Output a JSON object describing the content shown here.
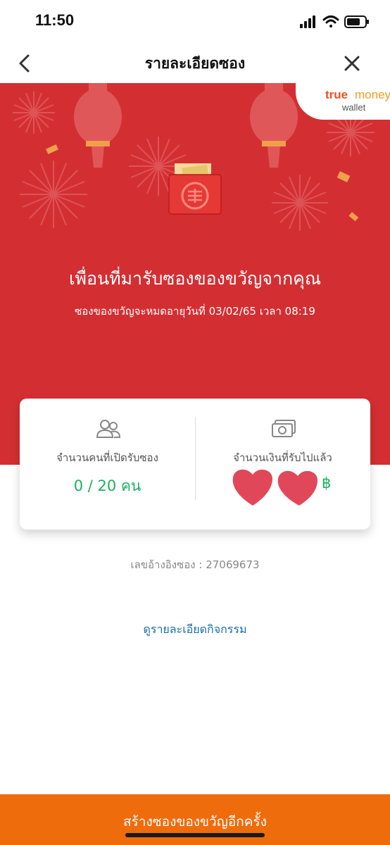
{
  "status_bar": {
    "time": "11:50",
    "signal_icon": "cellular-signal-icon",
    "wifi_icon": "wifi-icon",
    "battery_icon": "battery-icon"
  },
  "nav": {
    "title": "รายละเอียดซอง",
    "back_icon": "chevron-left-icon",
    "close_icon": "close-icon"
  },
  "brand": {
    "part1": "true",
    "part2": "money",
    "part3": "wallet"
  },
  "hero": {
    "title": "เพื่อนที่มารับซองของขวัญจากคุณ",
    "subtitle": "ซองของขวัญจะหมดอายุวันที่ 03/02/65 เวลา 08:19"
  },
  "stats": {
    "people_icon": "people-icon",
    "people_label": "จำนวนคนที่เปิดรับซอง",
    "people_value": "0 / 20 คน",
    "money_icon": "banknote-icon",
    "money_label": "จำนวนเงินที่รับไปแล้ว",
    "money_currency": "฿"
  },
  "reference": {
    "text": "เลขอ้างอิงซอง : 27069673"
  },
  "activity_link": "ดูรายละเอียดกิจกรรม",
  "cta": {
    "label": "สร้างซองของขวัญอีกครั้ง"
  },
  "colors": {
    "hero_bg": "#d32f33",
    "accent_green": "#1ab15f",
    "cta_orange": "#ee6c0c",
    "link_blue": "#1a6fa8"
  }
}
